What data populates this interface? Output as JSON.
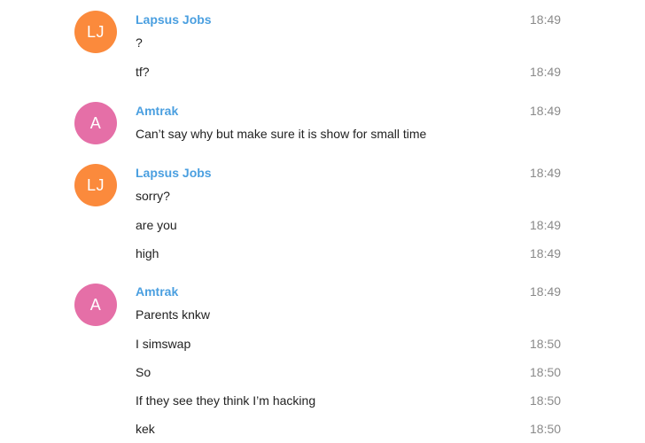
{
  "colors": {
    "sender_name": "#4a9fe0",
    "message_text": "#222222",
    "timestamp": "#8a8a8a",
    "avatar_lj": "#fb8a3c",
    "avatar_a": "#e56fa7"
  },
  "groups": [
    {
      "sender": "Lapsus Jobs",
      "avatar_initials": "LJ",
      "messages": [
        {
          "text": "?",
          "time": "18:49"
        },
        {
          "text": "tf?",
          "time": "18:49"
        }
      ]
    },
    {
      "sender": "Amtrak",
      "avatar_initials": "A",
      "messages": [
        {
          "text": "Can’t say why but make sure it is show for small time",
          "time": "18:49"
        }
      ]
    },
    {
      "sender": "Lapsus Jobs",
      "avatar_initials": "LJ",
      "messages": [
        {
          "text": "sorry?",
          "time": "18:49"
        },
        {
          "text": "are you",
          "time": "18:49"
        },
        {
          "text": "high",
          "time": "18:49"
        }
      ]
    },
    {
      "sender": "Amtrak",
      "avatar_initials": "A",
      "messages": [
        {
          "text": "Parents knkw",
          "time": "18:49"
        },
        {
          "text": "I simswap",
          "time": "18:50"
        },
        {
          "text": "So",
          "time": "18:50"
        },
        {
          "text": "If they see they think I’m hacking",
          "time": "18:50"
        },
        {
          "text": "kek",
          "time": "18:50"
        }
      ]
    }
  ]
}
